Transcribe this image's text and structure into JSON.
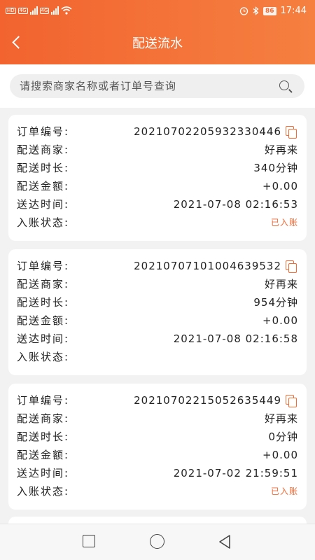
{
  "statusbar": {
    "left_tags": [
      "HD",
      "4G",
      "4G"
    ],
    "battery": "86",
    "time": "17:44"
  },
  "header": {
    "title": "配送流水"
  },
  "search": {
    "placeholder": "请搜索商家名称或者订单号查询"
  },
  "field_labels": {
    "order_no": "订单编号:",
    "merchant": "配送商家:",
    "duration": "配送时长:",
    "amount": "配送金额:",
    "delivered_time": "送达时间:",
    "account_status": "入账状态:"
  },
  "orders": [
    {
      "order_no": "20210702205932330446",
      "merchant": "好再来",
      "duration": "340分钟",
      "amount": "+0.00",
      "delivered_time": "2021-07-08 02:16:53",
      "account_status": "已入账"
    },
    {
      "order_no": "20210707101004639532",
      "merchant": "好再来",
      "duration": "954分钟",
      "amount": "+0.00",
      "delivered_time": "2021-07-08 02:16:58",
      "account_status": ""
    },
    {
      "order_no": "20210702215052635449",
      "merchant": "好再来",
      "duration": "0分钟",
      "amount": "+0.00",
      "delivered_time": "2021-07-02 21:59:51",
      "account_status": "已入账"
    }
  ],
  "colors": {
    "accent": "#f26a35",
    "header_start": "#f2632f",
    "header_end": "#f58040"
  },
  "icons": [
    "back-arrow-icon",
    "search-icon",
    "copy-icon",
    "nav-recent-icon",
    "nav-home-icon",
    "nav-back-icon"
  ]
}
